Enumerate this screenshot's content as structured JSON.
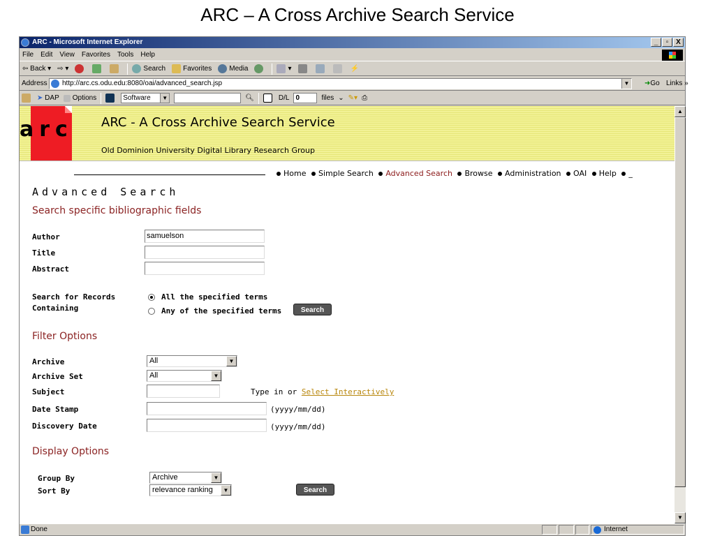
{
  "slide": {
    "title": "ARC – A Cross Archive Search Service"
  },
  "window": {
    "title": "ARC - Microsoft Internet Explorer",
    "minimize": "_",
    "maximize": "▫",
    "close": "X"
  },
  "menu": [
    "File",
    "Edit",
    "View",
    "Favorites",
    "Tools",
    "Help"
  ],
  "toolbar": {
    "back": "Back",
    "search": "Search",
    "favorites": "Favorites",
    "media": "Media"
  },
  "address": {
    "label": "Address",
    "url": "http://arc.cs.odu.edu:8080/oai/advanced_search.jsp",
    "go": "Go",
    "links": "Links »"
  },
  "linksbar": {
    "dap": "DAP",
    "options": "Options",
    "software": "Software",
    "dl": "D/L",
    "dl_count": "0",
    "files": "files"
  },
  "banner": {
    "logo": "arc",
    "title": "ARC - A Cross Archive Search Service",
    "subtitle": "Old Dominion University Digital Library Research Group"
  },
  "nav": {
    "home": "Home",
    "simple": "Simple Search",
    "advanced": "Advanced Search",
    "browse": "Browse",
    "admin": "Administration",
    "oai": "OAI",
    "help": "Help",
    "trail": "_"
  },
  "page": {
    "heading": "Advanced Search",
    "bib_section": "Search specific bibliographic fields",
    "author_label": "Author",
    "author_value": "samuelson",
    "title_label": "Title",
    "title_value": "",
    "abstract_label": "Abstract",
    "abstract_value": "",
    "records_label_1": "Search for Records",
    "records_label_2": "Containing",
    "radio_all": "All the specified terms",
    "radio_any": "Any of the specified terms",
    "radio_selected": "all",
    "search_btn": "Search",
    "filter_section": "Filter Options",
    "archive_label": "Archive",
    "archive_value": "All",
    "archive_set_label": "Archive Set",
    "archive_set_value": "All",
    "subject_label": "Subject",
    "subject_value": "",
    "subject_note": "Type in or",
    "subject_link": "Select Interactively",
    "datestamp_label": "Date Stamp",
    "datestamp_value": "",
    "date_format": "(yyyy/mm/dd)",
    "discovery_label": "Discovery Date",
    "discovery_value": "",
    "display_section": "Display Options",
    "group_label": "Group By",
    "group_value": "Archive",
    "sort_label": "Sort By",
    "sort_value": "relevance ranking",
    "search_btn2": "Search"
  },
  "status": {
    "text": "Done",
    "zone": "Internet"
  }
}
